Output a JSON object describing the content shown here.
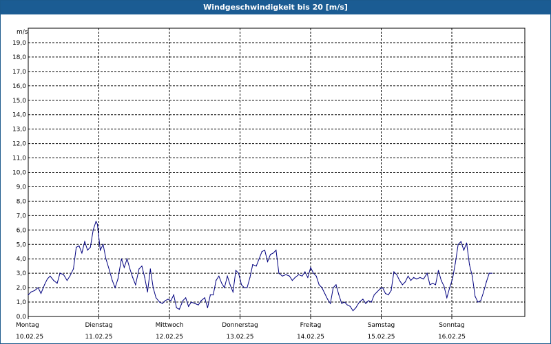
{
  "window": {
    "title": "Windgeschwindigkeit bis 20 [m/s]"
  },
  "chart_data": {
    "type": "line",
    "title": "Windgeschwindigkeit bis 20 [m/s]",
    "ylabel": "m/s",
    "ylim": [
      0,
      20
    ],
    "ytick_labels": [
      "0,0",
      "1,0",
      "2,0",
      "3,0",
      "4,0",
      "5,0",
      "6,0",
      "7,0",
      "8,0",
      "9,0",
      "10,0",
      "11,0",
      "12,0",
      "13,0",
      "14,0",
      "15,0",
      "16,0",
      "17,0",
      "18,0",
      "19,0"
    ],
    "day_labels": [
      {
        "day": "Montag",
        "date": "10.02.25"
      },
      {
        "day": "Dienstag",
        "date": "11.02.25"
      },
      {
        "day": "Mittwoch",
        "date": "12.02.25"
      },
      {
        "day": "Donnerstag",
        "date": "13.02.25"
      },
      {
        "day": "Freitag",
        "date": "14.02.25"
      },
      {
        "day": "Samstag",
        "date": "15.02.25"
      },
      {
        "day": "Sonntag",
        "date": "16.02.25"
      }
    ],
    "xlim_days": [
      0,
      7.08
    ],
    "grid": true,
    "colors": {
      "line": "#00007f",
      "grid": "#000000",
      "title_bar": "#1b5c93"
    },
    "series": [
      {
        "points": [
          [
            0.0,
            1.5
          ],
          [
            0.04,
            1.7
          ],
          [
            0.09,
            1.8
          ],
          [
            0.14,
            2.0
          ],
          [
            0.18,
            1.6
          ],
          [
            0.23,
            2.2
          ],
          [
            0.27,
            2.6
          ],
          [
            0.31,
            2.8
          ],
          [
            0.36,
            2.5
          ],
          [
            0.41,
            2.3
          ],
          [
            0.45,
            3.0
          ],
          [
            0.5,
            2.9
          ],
          [
            0.55,
            2.5
          ],
          [
            0.59,
            2.8
          ],
          [
            0.64,
            3.3
          ],
          [
            0.68,
            4.8
          ],
          [
            0.72,
            4.9
          ],
          [
            0.76,
            4.4
          ],
          [
            0.8,
            5.2
          ],
          [
            0.84,
            4.6
          ],
          [
            0.88,
            4.8
          ],
          [
            0.92,
            6.0
          ],
          [
            0.96,
            6.6
          ],
          [
            0.98,
            6.4
          ],
          [
            1.02,
            4.6
          ],
          [
            1.06,
            5.0
          ],
          [
            1.1,
            4.0
          ],
          [
            1.15,
            3.2
          ],
          [
            1.19,
            2.5
          ],
          [
            1.23,
            2.0
          ],
          [
            1.27,
            2.6
          ],
          [
            1.32,
            4.0
          ],
          [
            1.36,
            3.4
          ],
          [
            1.4,
            4.0
          ],
          [
            1.44,
            3.3
          ],
          [
            1.48,
            2.7
          ],
          [
            1.52,
            2.2
          ],
          [
            1.57,
            3.3
          ],
          [
            1.61,
            3.5
          ],
          [
            1.65,
            2.7
          ],
          [
            1.69,
            1.7
          ],
          [
            1.73,
            3.3
          ],
          [
            1.77,
            2.0
          ],
          [
            1.81,
            1.3
          ],
          [
            1.86,
            1.0
          ],
          [
            1.9,
            0.9
          ],
          [
            1.94,
            1.1
          ],
          [
            1.98,
            1.2
          ],
          [
            2.02,
            1.1
          ],
          [
            2.06,
            1.5
          ],
          [
            2.1,
            0.6
          ],
          [
            2.14,
            0.5
          ],
          [
            2.19,
            1.1
          ],
          [
            2.23,
            1.3
          ],
          [
            2.27,
            0.7
          ],
          [
            2.31,
            1.0
          ],
          [
            2.36,
            0.9
          ],
          [
            2.41,
            0.8
          ],
          [
            2.45,
            1.1
          ],
          [
            2.5,
            1.3
          ],
          [
            2.54,
            0.6
          ],
          [
            2.58,
            1.5
          ],
          [
            2.62,
            1.5
          ],
          [
            2.66,
            2.5
          ],
          [
            2.7,
            2.8
          ],
          [
            2.74,
            2.3
          ],
          [
            2.78,
            2.0
          ],
          [
            2.82,
            2.8
          ],
          [
            2.86,
            2.2
          ],
          [
            2.9,
            1.7
          ],
          [
            2.94,
            3.2
          ],
          [
            2.98,
            3.0
          ],
          [
            3.02,
            2.2
          ],
          [
            3.06,
            2.0
          ],
          [
            3.1,
            2.0
          ],
          [
            3.14,
            2.7
          ],
          [
            3.18,
            3.6
          ],
          [
            3.23,
            3.5
          ],
          [
            3.27,
            4.0
          ],
          [
            3.31,
            4.5
          ],
          [
            3.35,
            4.6
          ],
          [
            3.39,
            3.8
          ],
          [
            3.43,
            4.3
          ],
          [
            3.47,
            4.4
          ],
          [
            3.51,
            4.6
          ],
          [
            3.55,
            3.0
          ],
          [
            3.6,
            2.8
          ],
          [
            3.65,
            2.9
          ],
          [
            3.7,
            2.8
          ],
          [
            3.74,
            2.5
          ],
          [
            3.78,
            2.7
          ],
          [
            3.83,
            2.9
          ],
          [
            3.88,
            2.8
          ],
          [
            3.92,
            3.1
          ],
          [
            3.96,
            2.7
          ],
          [
            4.0,
            3.4
          ],
          [
            4.04,
            3.0
          ],
          [
            4.08,
            2.8
          ],
          [
            4.12,
            2.2
          ],
          [
            4.16,
            2.0
          ],
          [
            4.2,
            1.6
          ],
          [
            4.24,
            1.2
          ],
          [
            4.28,
            0.9
          ],
          [
            4.32,
            2.0
          ],
          [
            4.36,
            2.2
          ],
          [
            4.4,
            1.5
          ],
          [
            4.44,
            0.9
          ],
          [
            4.48,
            1.0
          ],
          [
            4.52,
            0.8
          ],
          [
            4.56,
            0.7
          ],
          [
            4.6,
            0.4
          ],
          [
            4.64,
            0.6
          ],
          [
            4.69,
            1.0
          ],
          [
            4.74,
            1.2
          ],
          [
            4.78,
            0.9
          ],
          [
            4.82,
            1.1
          ],
          [
            4.86,
            1.0
          ],
          [
            4.9,
            1.5
          ],
          [
            4.94,
            1.7
          ],
          [
            4.98,
            1.9
          ],
          [
            5.02,
            2.0
          ],
          [
            5.06,
            1.6
          ],
          [
            5.1,
            1.5
          ],
          [
            5.14,
            1.8
          ],
          [
            5.18,
            3.1
          ],
          [
            5.22,
            2.9
          ],
          [
            5.26,
            2.5
          ],
          [
            5.3,
            2.2
          ],
          [
            5.34,
            2.4
          ],
          [
            5.38,
            2.8
          ],
          [
            5.42,
            2.5
          ],
          [
            5.46,
            2.7
          ],
          [
            5.5,
            2.6
          ],
          [
            5.55,
            2.7
          ],
          [
            5.6,
            2.6
          ],
          [
            5.65,
            3.0
          ],
          [
            5.69,
            2.2
          ],
          [
            5.73,
            2.3
          ],
          [
            5.77,
            2.2
          ],
          [
            5.81,
            3.2
          ],
          [
            5.85,
            2.5
          ],
          [
            5.89,
            2.1
          ],
          [
            5.93,
            1.3
          ],
          [
            5.97,
            2.0
          ],
          [
            6.01,
            2.6
          ],
          [
            6.05,
            3.7
          ],
          [
            6.09,
            5.0
          ],
          [
            6.13,
            5.2
          ],
          [
            6.17,
            4.6
          ],
          [
            6.21,
            5.1
          ],
          [
            6.25,
            3.6
          ],
          [
            6.29,
            2.8
          ],
          [
            6.33,
            1.4
          ],
          [
            6.37,
            1.0
          ],
          [
            6.41,
            1.1
          ],
          [
            6.45,
            1.7
          ],
          [
            6.49,
            2.4
          ],
          [
            6.53,
            3.0
          ],
          [
            6.57,
            3.0
          ]
        ]
      }
    ]
  }
}
